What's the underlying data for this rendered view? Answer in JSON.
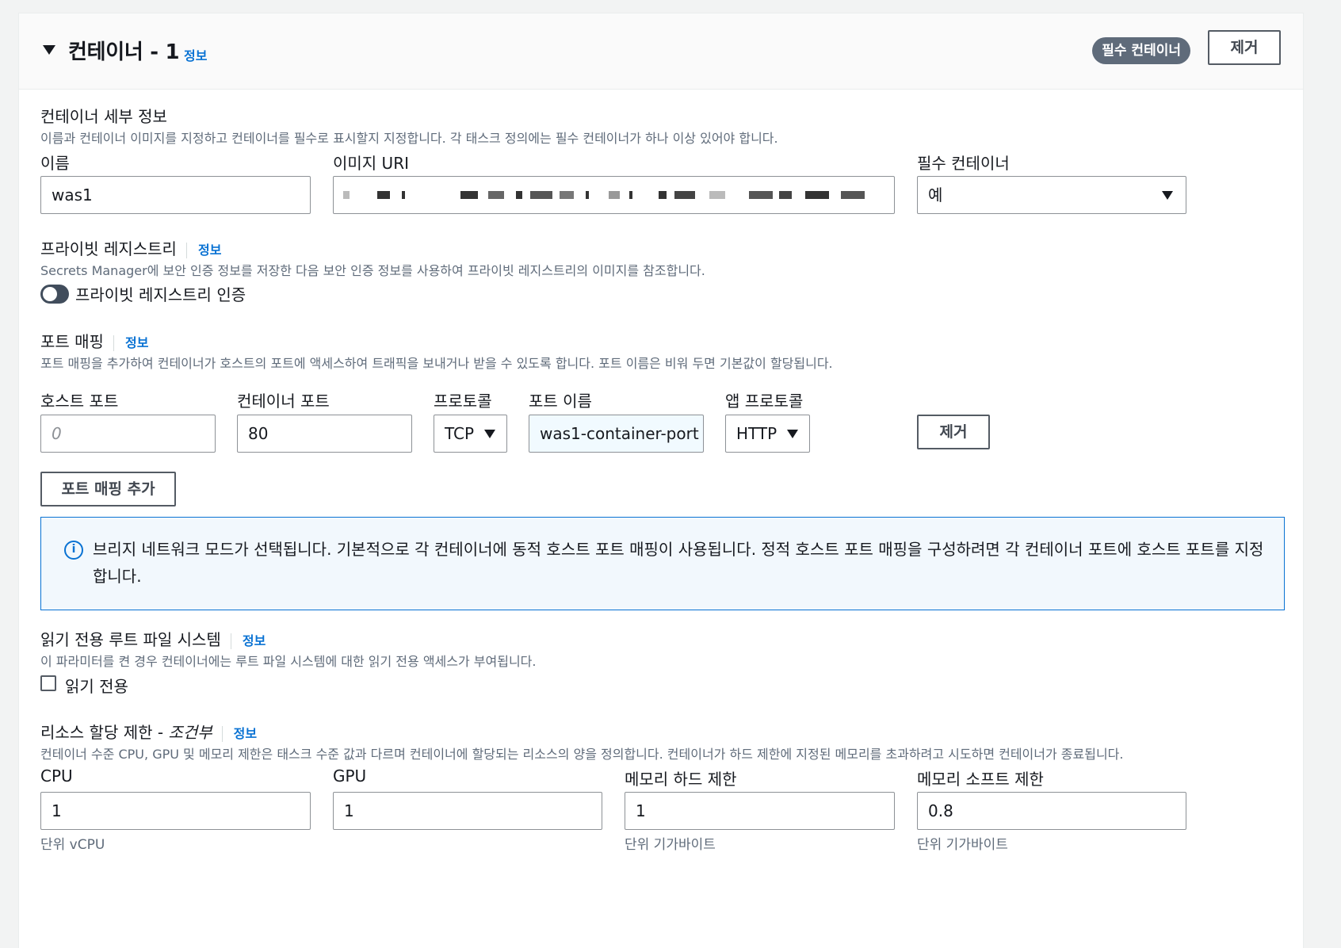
{
  "header": {
    "title": "컨테이너 - 1",
    "info": "정보",
    "badge": "필수 컨테이너",
    "remove_label": "제거"
  },
  "details": {
    "title": "컨테이너 세부 정보",
    "description": "이름과 컨테이너 이미지를 지정하고 컨테이너를 필수로 표시할지 지정합니다. 각 태스크 정의에는 필수 컨테이너가 하나 이상 있어야 합니다.",
    "name_label": "이름",
    "name_value": "was1",
    "image_label": "이미지 URI",
    "essential_label": "필수 컨테이너",
    "essential_value": "예"
  },
  "registry": {
    "title": "프라이빗 레지스트리",
    "info": "정보",
    "description": "Secrets Manager에 보안 인증 정보를 저장한 다음 보안 인증 정보를 사용하여 프라이빗 레지스트리의 이미지를 참조합니다.",
    "toggle_label": "프라이빗 레지스트리 인증"
  },
  "port_mapping": {
    "title": "포트 매핑",
    "info": "정보",
    "description": "포트 매핑을 추가하여 컨테이너가 호스트의 포트에 액세스하여 트래픽을 보내거나 받을 수 있도록 합니다. 포트 이름은 비워 두면 기본값이 할당됩니다.",
    "host_port_label": "호스트 포트",
    "host_port_placeholder": "0",
    "container_port_label": "컨테이너 포트",
    "container_port_value": "80",
    "protocol_label": "프로토콜",
    "protocol_value": "TCP",
    "port_name_label": "포트 이름",
    "port_name_value": "was1-container-port",
    "app_protocol_label": "앱 프로토콜",
    "app_protocol_value": "HTTP",
    "remove_label": "제거",
    "add_label": "포트 매핑 추가"
  },
  "alert": {
    "icon": "info-icon",
    "text": "브리지 네트워크 모드가 선택됩니다. 기본적으로 각 컨테이너에 동적 호스트 포트 매핑이 사용됩니다. 정적 호스트 포트 매핑을 구성하려면 각 컨테이너 포트에 호스트 포트를 지정합니다."
  },
  "readonly": {
    "title": "읽기 전용 루트 파일 시스템",
    "info": "정보",
    "description": "이 파라미터를 켠 경우 컨테이너에는 루트 파일 시스템에 대한 읽기 전용 액세스가 부여됩니다.",
    "checkbox_label": "읽기 전용"
  },
  "resources": {
    "title": "리소스 할당 제한 - ",
    "title_italic": "조건부",
    "info": "정보",
    "description": "컨테이너 수준 CPU, GPU 및 메모리 제한은 태스크 수준 값과 다르며 컨테이너에 할당되는 리소스의 양을 정의합니다. 컨테이너가 하드 제한에 지정된 메모리를 초과하려고 시도하면 컨테이너가 종료됩니다.",
    "cpu_label": "CPU",
    "cpu_value": "1",
    "cpu_unit": "단위 vCPU",
    "gpu_label": "GPU",
    "gpu_value": "1",
    "mem_hard_label": "메모리 하드 제한",
    "mem_hard_value": "1",
    "mem_hard_unit": "단위 기가바이트",
    "mem_soft_label": "메모리 소프트 제한",
    "mem_soft_value": "0.8",
    "mem_soft_unit": "단위 기가바이트"
  }
}
